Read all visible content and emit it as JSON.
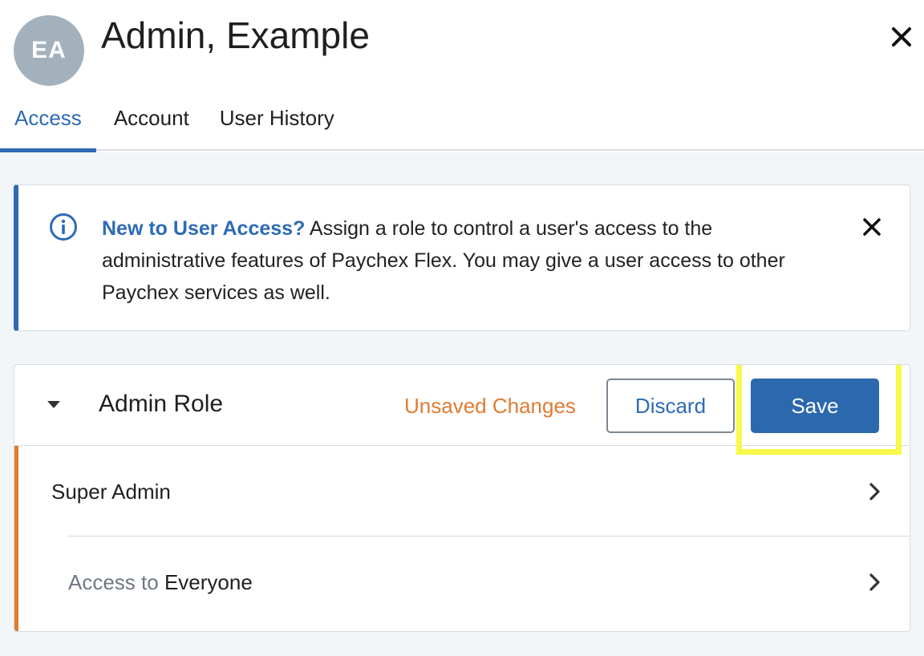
{
  "header": {
    "avatar_initials": "EA",
    "user_name": "Admin, Example",
    "close_icon": "close-icon",
    "tabs": [
      {
        "label": "Access",
        "active": true
      },
      {
        "label": "Account",
        "active": false
      },
      {
        "label": "User History",
        "active": false
      }
    ]
  },
  "info_banner": {
    "icon": "info-icon",
    "highlight": "New to User Access?",
    "text": " Assign a role to control a user's access to the administrative features of Paychex Flex. You may give a user access to other Paychex services as well.",
    "close_icon": "close-icon"
  },
  "role_panel": {
    "title": "Admin Role",
    "status": "Unsaved Changes",
    "discard_label": "Discard",
    "save_label": "Save",
    "rows": [
      {
        "label": "Super Admin"
      },
      {
        "prefix": "Access to ",
        "value": "Everyone"
      }
    ]
  },
  "colors": {
    "accent": "#2d6bb5",
    "warning": "#e07b32",
    "highlight": "#f8f84a",
    "avatar": "#a3b1bc"
  }
}
